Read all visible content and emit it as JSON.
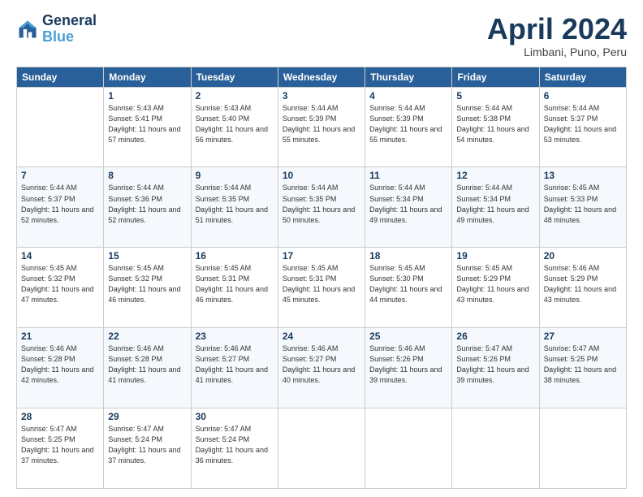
{
  "header": {
    "logo_line1": "General",
    "logo_line2": "Blue",
    "title": "April 2024",
    "subtitle": "Limbani, Puno, Peru"
  },
  "weekdays": [
    "Sunday",
    "Monday",
    "Tuesday",
    "Wednesday",
    "Thursday",
    "Friday",
    "Saturday"
  ],
  "weeks": [
    [
      {
        "day": "",
        "info": ""
      },
      {
        "day": "1",
        "info": "Sunrise: 5:43 AM\nSunset: 5:41 PM\nDaylight: 11 hours\nand 57 minutes."
      },
      {
        "day": "2",
        "info": "Sunrise: 5:43 AM\nSunset: 5:40 PM\nDaylight: 11 hours\nand 56 minutes."
      },
      {
        "day": "3",
        "info": "Sunrise: 5:44 AM\nSunset: 5:39 PM\nDaylight: 11 hours\nand 55 minutes."
      },
      {
        "day": "4",
        "info": "Sunrise: 5:44 AM\nSunset: 5:39 PM\nDaylight: 11 hours\nand 55 minutes."
      },
      {
        "day": "5",
        "info": "Sunrise: 5:44 AM\nSunset: 5:38 PM\nDaylight: 11 hours\nand 54 minutes."
      },
      {
        "day": "6",
        "info": "Sunrise: 5:44 AM\nSunset: 5:37 PM\nDaylight: 11 hours\nand 53 minutes."
      }
    ],
    [
      {
        "day": "7",
        "info": "Sunrise: 5:44 AM\nSunset: 5:37 PM\nDaylight: 11 hours\nand 52 minutes."
      },
      {
        "day": "8",
        "info": "Sunrise: 5:44 AM\nSunset: 5:36 PM\nDaylight: 11 hours\nand 52 minutes."
      },
      {
        "day": "9",
        "info": "Sunrise: 5:44 AM\nSunset: 5:35 PM\nDaylight: 11 hours\nand 51 minutes."
      },
      {
        "day": "10",
        "info": "Sunrise: 5:44 AM\nSunset: 5:35 PM\nDaylight: 11 hours\nand 50 minutes."
      },
      {
        "day": "11",
        "info": "Sunrise: 5:44 AM\nSunset: 5:34 PM\nDaylight: 11 hours\nand 49 minutes."
      },
      {
        "day": "12",
        "info": "Sunrise: 5:44 AM\nSunset: 5:34 PM\nDaylight: 11 hours\nand 49 minutes."
      },
      {
        "day": "13",
        "info": "Sunrise: 5:45 AM\nSunset: 5:33 PM\nDaylight: 11 hours\nand 48 minutes."
      }
    ],
    [
      {
        "day": "14",
        "info": "Sunrise: 5:45 AM\nSunset: 5:32 PM\nDaylight: 11 hours\nand 47 minutes."
      },
      {
        "day": "15",
        "info": "Sunrise: 5:45 AM\nSunset: 5:32 PM\nDaylight: 11 hours\nand 46 minutes."
      },
      {
        "day": "16",
        "info": "Sunrise: 5:45 AM\nSunset: 5:31 PM\nDaylight: 11 hours\nand 46 minutes."
      },
      {
        "day": "17",
        "info": "Sunrise: 5:45 AM\nSunset: 5:31 PM\nDaylight: 11 hours\nand 45 minutes."
      },
      {
        "day": "18",
        "info": "Sunrise: 5:45 AM\nSunset: 5:30 PM\nDaylight: 11 hours\nand 44 minutes."
      },
      {
        "day": "19",
        "info": "Sunrise: 5:45 AM\nSunset: 5:29 PM\nDaylight: 11 hours\nand 43 minutes."
      },
      {
        "day": "20",
        "info": "Sunrise: 5:46 AM\nSunset: 5:29 PM\nDaylight: 11 hours\nand 43 minutes."
      }
    ],
    [
      {
        "day": "21",
        "info": "Sunrise: 5:46 AM\nSunset: 5:28 PM\nDaylight: 11 hours\nand 42 minutes."
      },
      {
        "day": "22",
        "info": "Sunrise: 5:46 AM\nSunset: 5:28 PM\nDaylight: 11 hours\nand 41 minutes."
      },
      {
        "day": "23",
        "info": "Sunrise: 5:46 AM\nSunset: 5:27 PM\nDaylight: 11 hours\nand 41 minutes."
      },
      {
        "day": "24",
        "info": "Sunrise: 5:46 AM\nSunset: 5:27 PM\nDaylight: 11 hours\nand 40 minutes."
      },
      {
        "day": "25",
        "info": "Sunrise: 5:46 AM\nSunset: 5:26 PM\nDaylight: 11 hours\nand 39 minutes."
      },
      {
        "day": "26",
        "info": "Sunrise: 5:47 AM\nSunset: 5:26 PM\nDaylight: 11 hours\nand 39 minutes."
      },
      {
        "day": "27",
        "info": "Sunrise: 5:47 AM\nSunset: 5:25 PM\nDaylight: 11 hours\nand 38 minutes."
      }
    ],
    [
      {
        "day": "28",
        "info": "Sunrise: 5:47 AM\nSunset: 5:25 PM\nDaylight: 11 hours\nand 37 minutes."
      },
      {
        "day": "29",
        "info": "Sunrise: 5:47 AM\nSunset: 5:24 PM\nDaylight: 11 hours\nand 37 minutes."
      },
      {
        "day": "30",
        "info": "Sunrise: 5:47 AM\nSunset: 5:24 PM\nDaylight: 11 hours\nand 36 minutes."
      },
      {
        "day": "",
        "info": ""
      },
      {
        "day": "",
        "info": ""
      },
      {
        "day": "",
        "info": ""
      },
      {
        "day": "",
        "info": ""
      }
    ]
  ]
}
